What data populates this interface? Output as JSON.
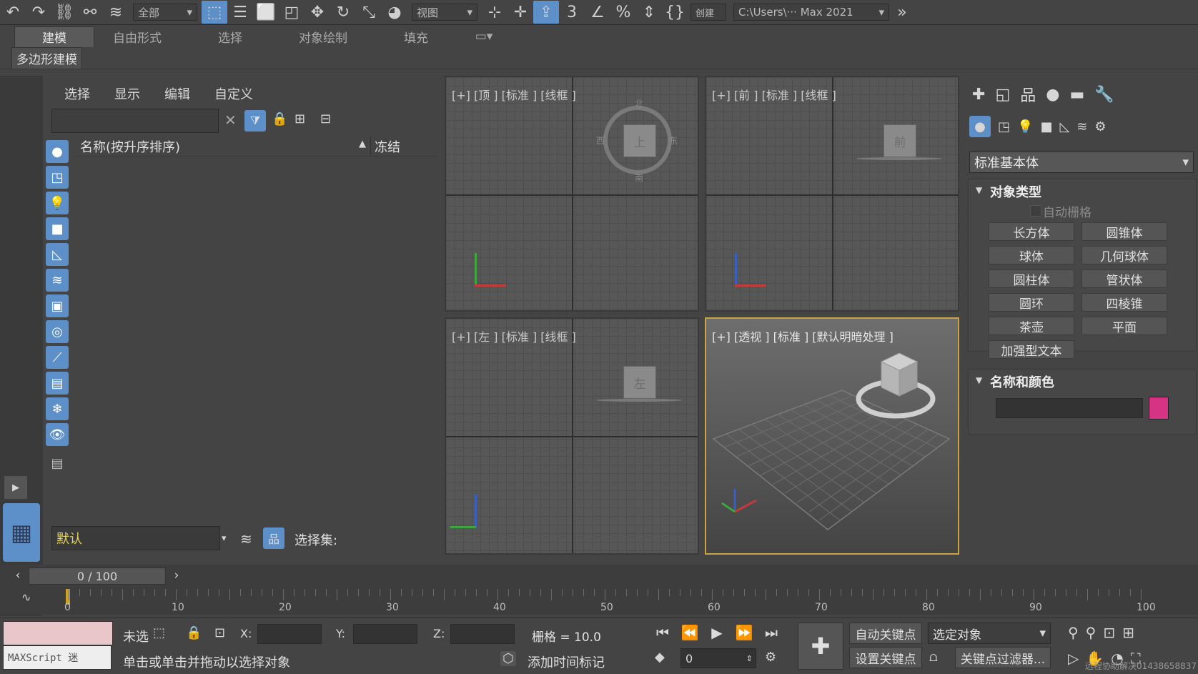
{
  "toolbar": {
    "selection_filter": "全部",
    "ref_coord": "视图",
    "create_sel": "创建",
    "project_path": "C:\\Users\\··· Max 2021"
  },
  "ribbon": {
    "tabs": [
      "建模",
      "自由形式",
      "选择",
      "对象绘制",
      "填充"
    ],
    "sub_label": "多边形建模"
  },
  "explorer": {
    "menu": [
      "选择",
      "显示",
      "编辑",
      "自定义"
    ],
    "col_name": "名称(按升序排序)",
    "sort_arrow": "▲",
    "col_frozen": "冻结",
    "layer_value": "默认",
    "selection_set_label": "选择集:"
  },
  "viewports": {
    "top": "[+] [顶 ] [标准 ] [线框 ]",
    "front": "[+] [前 ] [标准 ] [线框 ]",
    "left": "[+] [左 ] [标准 ] [线框 ]",
    "persp": "[+] [透视 ] [标准 ] [默认明暗处理 ]",
    "cube_top": "上",
    "cube_front": "前",
    "cube_left": "左",
    "compass_n": "北",
    "compass_s": "南",
    "compass_e": "东",
    "compass_w": "西"
  },
  "command_panel": {
    "dropdown": "标准基本体",
    "rollout_object_type": "对象类型",
    "autogrid": "自动栅格",
    "buttons": [
      "长方体",
      "圆锥体",
      "球体",
      "几何球体",
      "圆柱体",
      "管状体",
      "圆环",
      "四棱锥",
      "茶壶",
      "平面",
      "加强型文本"
    ],
    "rollout_name_color": "名称和颜色",
    "color_swatch": "#d63384"
  },
  "timeline": {
    "frame_display": "0 / 100",
    "ticks": [
      "0",
      "10",
      "20",
      "30",
      "40",
      "50",
      "60",
      "70",
      "80",
      "90",
      "100"
    ]
  },
  "status": {
    "maxscript": "MAXScript 迷",
    "not_selected": "未选",
    "x_label": "X:",
    "y_label": "Y:",
    "z_label": "Z:",
    "grid": "栅格 = 10.0",
    "prompt": "单击或单击并拖动以选择对象",
    "add_time_tag": "添加时间标记",
    "auto_key": "自动关键点",
    "selected_object": "选定对象",
    "set_key": "设置关键点",
    "key_filters": "关键点过滤器...",
    "frame_value": "0",
    "watermark": "远程协助解决01438658837"
  }
}
